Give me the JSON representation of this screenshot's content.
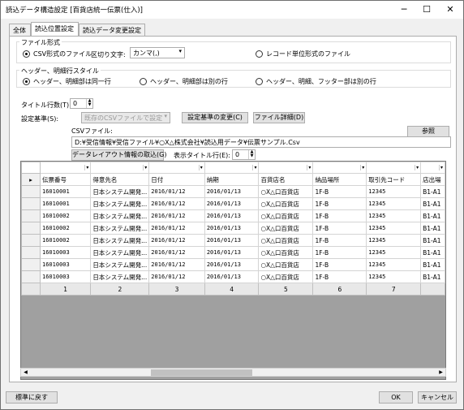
{
  "window": {
    "title": "読込データ構造設定 [百貨店統一伝票(仕入)]",
    "minimize": "─",
    "maximize": "☐",
    "close": "✕"
  },
  "tabs": [
    {
      "label": "全体"
    },
    {
      "label": "読込位置設定"
    },
    {
      "label": "読込データ変更設定"
    }
  ],
  "file_format": {
    "group_label": "ファイル形式",
    "csv_option": "CSV形式のファイル",
    "delimiter_label": "区切り文字:",
    "delimiter_value": "カンマ(,)",
    "record_option": "レコード単位形式のファイル"
  },
  "header_style": {
    "group_label": "ヘッダー、明細行スタイル",
    "option1": "ヘッダー、明細部は同一行",
    "option2": "ヘッダー、明細部は別の行",
    "option3": "ヘッダー、明細、フッター部は別の行"
  },
  "title_rows": {
    "label": "タイトル行数(T):",
    "value": "0"
  },
  "setting_standard": {
    "label": "設定基準(S):",
    "value": "既存のCSVファイルで設定",
    "change_button": "設定基準の変更(C)",
    "detail_button": "ファイル詳細(D)"
  },
  "csv_file": {
    "label": "CSVファイル:",
    "browse_button": "参照",
    "path": "D:¥受信情報¥受信ファイル¥○X△株式会社¥読込用データ¥伝票サンプル.Csv",
    "import_button": "データレイアウト情報の取込(G)",
    "display_title_label": "表示タイトル行(E):",
    "display_title_value": "0"
  },
  "grid": {
    "current_row_marker": "▸",
    "dropdown_arrow": "▾",
    "headers": [
      "伝票番号",
      "得意先名",
      "日付",
      "納期",
      "百貨店名",
      "納品場所",
      "取引先コード",
      "店出場"
    ],
    "rows": [
      [
        "16010001",
        "日本システム開発...",
        "2016/01/12",
        "2016/01/13",
        "○X△口百貨店",
        "1F-B",
        "12345",
        "B1-A1"
      ],
      [
        "16010001",
        "日本システム開発...",
        "2016/01/12",
        "2016/01/13",
        "○X△口百貨店",
        "1F-B",
        "12345",
        "B1-A1"
      ],
      [
        "16010002",
        "日本システム開発...",
        "2016/01/12",
        "2016/01/13",
        "○X△口百貨店",
        "1F-B",
        "12345",
        "B1-A1"
      ],
      [
        "16010002",
        "日本システム開発...",
        "2016/01/12",
        "2016/01/13",
        "○X△口百貨店",
        "1F-B",
        "12345",
        "B1-A1"
      ],
      [
        "16010002",
        "日本システム開発...",
        "2016/01/12",
        "2016/01/13",
        "○X△口百貨店",
        "1F-B",
        "12345",
        "B1-A1"
      ],
      [
        "16010003",
        "日本システム開発...",
        "2016/01/12",
        "2016/01/13",
        "○X△口百貨店",
        "1F-B",
        "12345",
        "B1-A1"
      ],
      [
        "16010003",
        "日本システム開発...",
        "2016/01/12",
        "2016/01/13",
        "○X△口百貨店",
        "1F-B",
        "12345",
        "B1-A1"
      ],
      [
        "16010003",
        "日本システム開発...",
        "2016/01/12",
        "2016/01/13",
        "○X△口百貨店",
        "1F-B",
        "12345",
        "B1-A1"
      ]
    ],
    "column_numbers": [
      "1",
      "2",
      "3",
      "4",
      "5",
      "6",
      "7",
      ""
    ]
  },
  "footer": {
    "reset_button": "標準に戻す",
    "ok_button": "OK",
    "cancel_button": "キャンセル"
  }
}
